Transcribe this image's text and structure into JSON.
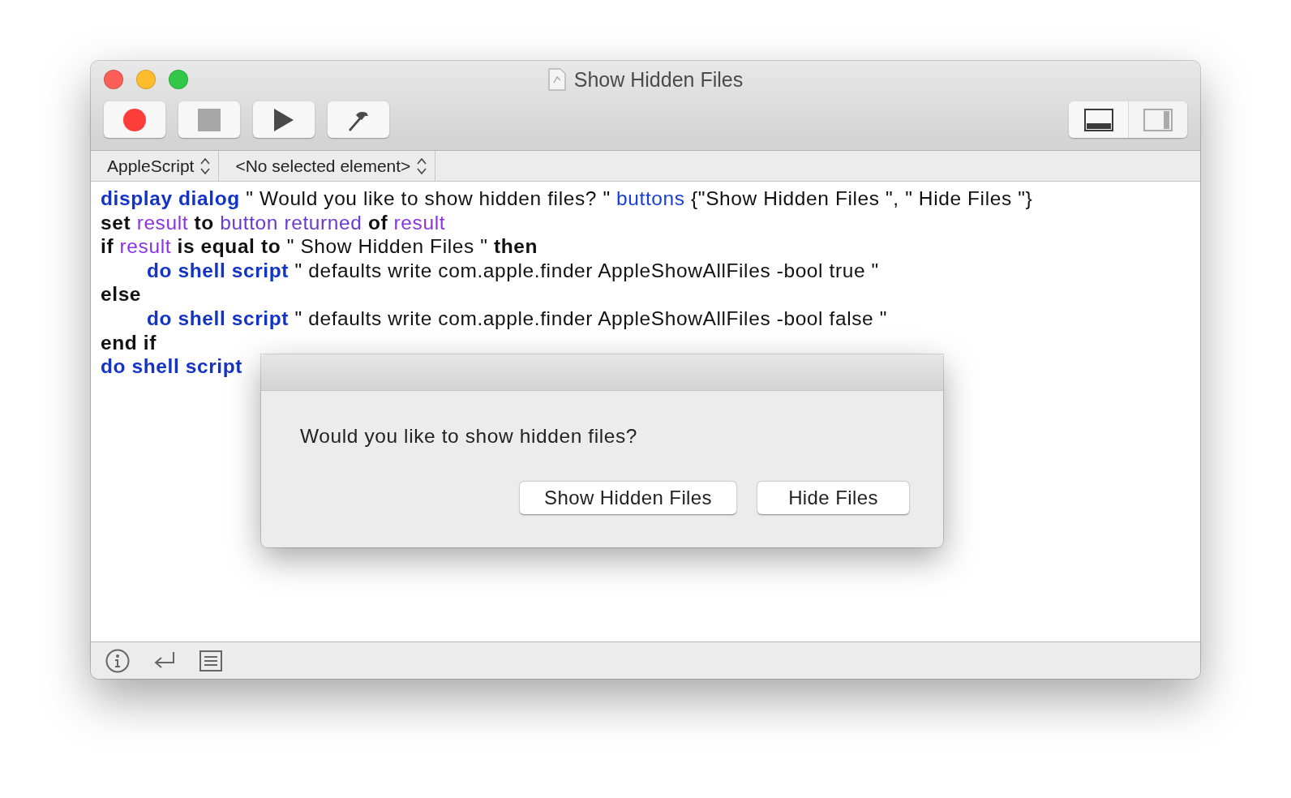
{
  "window": {
    "title": "Show Hidden Files"
  },
  "toolbar": {
    "buttons": [
      {
        "kind": "record"
      },
      {
        "kind": "stop"
      },
      {
        "kind": "run"
      },
      {
        "kind": "compile"
      }
    ],
    "view_toggles": [
      {
        "kind": "bottom-pane",
        "selected": true
      },
      {
        "kind": "side-pane",
        "selected": false
      }
    ]
  },
  "navigation_bar": {
    "language": "AppleScript",
    "element": "<No selected element>"
  },
  "editor": {
    "lines": [
      {
        "indented": false,
        "tokens": [
          {
            "kind": "command",
            "text": "display dialog"
          },
          {
            "kind": "plain",
            "text": " \" Would you like to show hidden files? \" "
          },
          {
            "kind": "parameter",
            "text": "buttons"
          },
          {
            "kind": "plain",
            "text": " {\"Show Hidden Files \", \" Hide Files \"}"
          }
        ]
      },
      {
        "indented": false,
        "tokens": [
          {
            "kind": "keyword",
            "text": "set"
          },
          {
            "kind": "variable",
            "text": " result"
          },
          {
            "kind": "keyword",
            "text": " to"
          },
          {
            "kind": "property",
            "text": " button returned"
          },
          {
            "kind": "keyword",
            "text": " of"
          },
          {
            "kind": "variable",
            "text": " result"
          }
        ]
      },
      {
        "indented": false,
        "tokens": [
          {
            "kind": "keyword",
            "text": "if"
          },
          {
            "kind": "variable",
            "text": " result"
          },
          {
            "kind": "keyword",
            "text": " is equal to"
          },
          {
            "kind": "plain",
            "text": " \" Show Hidden Files \" "
          },
          {
            "kind": "keyword",
            "text": "then"
          }
        ]
      },
      {
        "indented": true,
        "tokens": [
          {
            "kind": "command",
            "text": "do shell script"
          },
          {
            "kind": "plain",
            "text": " \" defaults write com.apple.finder AppleShowAllFiles -bool true \""
          }
        ]
      },
      {
        "indented": false,
        "tokens": [
          {
            "kind": "keyword",
            "text": "else"
          }
        ]
      },
      {
        "indented": true,
        "tokens": [
          {
            "kind": "command",
            "text": "do shell script"
          },
          {
            "kind": "plain",
            "text": " \" defaults write com.apple.finder AppleShowAllFiles -bool false \""
          }
        ]
      },
      {
        "indented": false,
        "tokens": [
          {
            "kind": "keyword",
            "text": "end if"
          }
        ]
      },
      {
        "indented": false,
        "tokens": [
          {
            "kind": "command",
            "text": "do shell script"
          }
        ]
      }
    ]
  },
  "dialog": {
    "message": "Would you like to show hidden files?",
    "buttons": [
      "Show Hidden Files",
      "Hide Files"
    ]
  },
  "bottom_bar": {
    "buttons": [
      {
        "kind": "info"
      },
      {
        "kind": "return"
      },
      {
        "kind": "list"
      }
    ]
  }
}
